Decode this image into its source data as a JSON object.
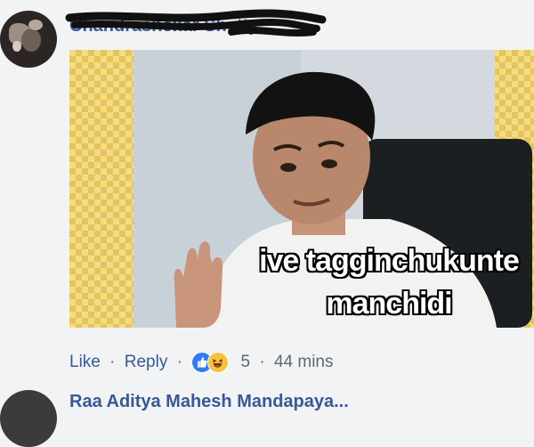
{
  "comment": {
    "author": "Chandrashekar Shetty",
    "image_caption_line1": "ive tagginchukunte",
    "image_caption_line2": "manchidi",
    "actions": {
      "like": "Like",
      "reply": "Reply",
      "reaction_count": "5",
      "time": "44 mins"
    },
    "reaction_icons": [
      "like-icon",
      "haha-icon"
    ],
    "colors": {
      "link": "#385898",
      "meta": "#616770",
      "like_blue": "#2e7cf6",
      "haha_yellow": "#f7c33e"
    }
  },
  "next_comment": {
    "author": "Raa Aditya Mahesh Mandapaya..."
  }
}
